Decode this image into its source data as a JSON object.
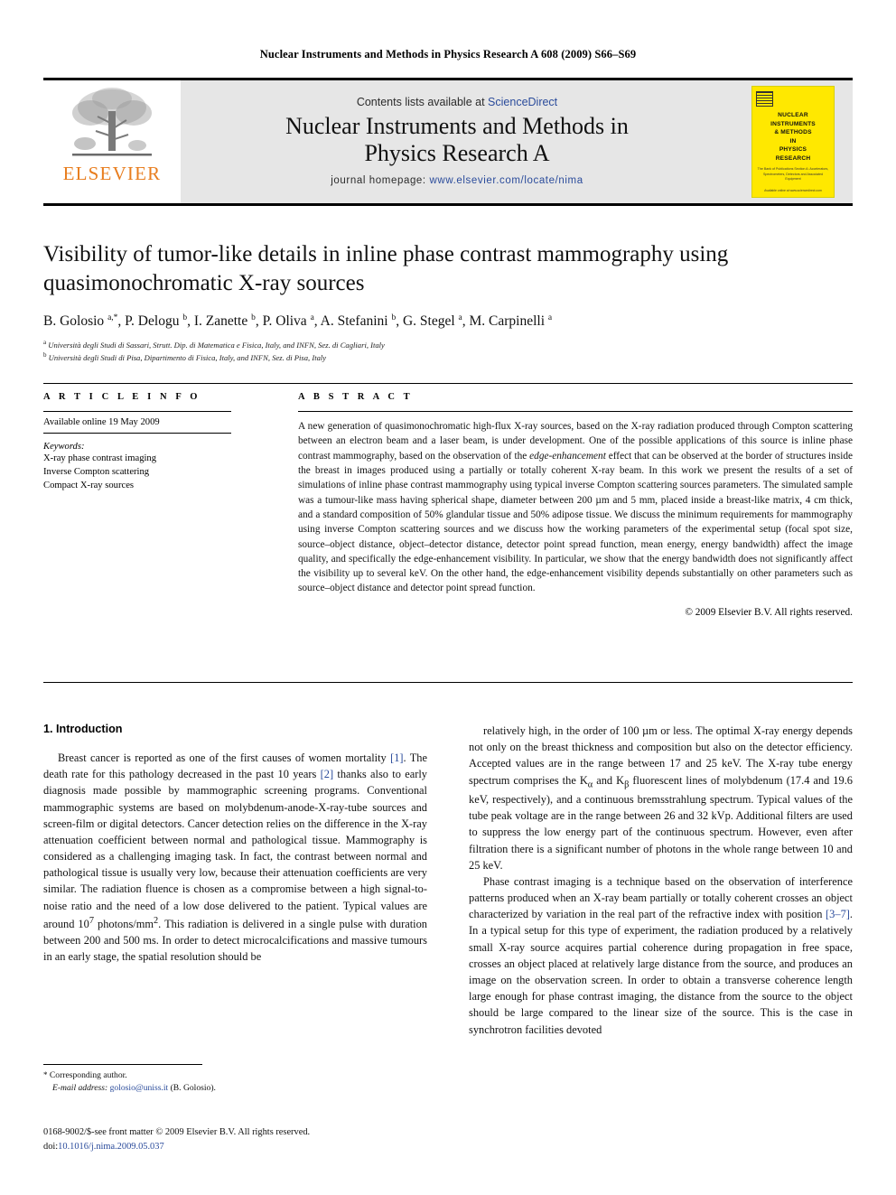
{
  "running_head": "Nuclear Instruments and Methods in Physics Research A 608 (2009) S66–S69",
  "masthead": {
    "publisher_logo_text": "ELSEVIER",
    "contents_prefix": "Contents lists available at",
    "contents_link": "ScienceDirect",
    "journal_title_line1": "Nuclear Instruments and Methods in",
    "journal_title_line2": "Physics Research A",
    "homepage_label": "journal homepage:",
    "homepage_url": "www.elsevier.com/locate/nima",
    "cover": {
      "title_line1": "NUCLEAR",
      "title_line2": "INSTRUMENTS",
      "title_line3": "& METHODS",
      "title_line4": "IN",
      "title_line5": "PHYSICS",
      "title_line6": "RESEARCH",
      "subtitle": "The Bank of Publications Section A: Accelerators, Spectrometers, Detectors and Associated Equipment",
      "footer": "Available online at www.sciencedirect.com"
    }
  },
  "article": {
    "title": "Visibility of tumor-like details in inline phase contrast mammography using quasimonochromatic X-ray sources",
    "authors_html": "B. Golosio <sup>a,</sup><sup>*</sup>, P. Delogu <sup>b</sup>, I. Zanette <sup>b</sup>, P. Oliva <sup>a</sup>, A. Stefanini <sup>b</sup>, G. Stegel <sup>a</sup>, M. Carpinelli <sup>a</sup>",
    "affiliation_a": "Università degli Studi di Sassari, Strutt. Dip. di Matematica e Fisica, Italy, and INFN, Sez. di Cagliari, Italy",
    "affiliation_b": "Università degli Studi di Pisa, Dipartimento di Fisica, Italy, and INFN, Sez. di Pisa, Italy"
  },
  "info": {
    "heading": "A R T I C L E   I N F O",
    "history": "Available online 19 May 2009",
    "keywords_label": "Keywords:",
    "keywords": [
      "X-ray phase contrast imaging",
      "Inverse Compton scattering",
      "Compact X-ray sources"
    ]
  },
  "abstract": {
    "heading": "A B S T R A C T",
    "paragraph_html": "A new generation of quasimonochromatic high-flux X-ray sources, based on the X-ray radiation produced through Compton scattering between an electron beam and a laser beam, is under development. One of the possible applications of this source is inline phase contrast mammography, based on the observation of the <i>edge-enhancement</i> effect that can be observed at the border of structures inside the breast in images produced using a partially or totally coherent X-ray beam. In this work we present the results of a set of simulations of inline phase contrast mammography using typical inverse Compton scattering sources parameters. The simulated sample was a tumour-like mass having spherical shape, diameter between 200 µm and 5 mm, placed inside a breast-like matrix, 4 cm thick, and a standard composition of 50% glandular tissue and 50% adipose tissue. We discuss the minimum requirements for mammography using inverse Compton scattering sources and we discuss how the working parameters of the experimental setup (focal spot size, source–object distance, object–detector distance, detector point spread function, mean energy, energy bandwidth) affect the image quality, and specifically the edge-enhancement visibility. In particular, we show that the energy bandwidth does not significantly affect the visibility up to several keV. On the other hand, the edge-enhancement visibility depends substantially on other parameters such as source–object distance and detector point spread function.",
    "copyright": "© 2009 Elsevier B.V. All rights reserved."
  },
  "body": {
    "section_title": "1.  Introduction",
    "left_paragraph_html": "Breast cancer is reported as one of the first causes of women mortality <span class=\"ref\">[1]</span>. The death rate for this pathology decreased in the past 10 years <span class=\"ref\">[2]</span> thanks also to early diagnosis made possible by mammographic screening programs. Conventional mammographic systems are based on molybdenum-anode-X-ray-tube sources and screen-film or digital detectors. Cancer detection relies on the difference in the X-ray attenuation coefficient between normal and pathological tissue. Mammography is considered as a challenging imaging task. In fact, the contrast between normal and pathological tissue is usually very low, because their attenuation coefficients are very similar. The radiation fluence is chosen as a compromise between a high signal-to-noise ratio and the need of a low dose delivered to the patient. Typical values are around 10<sup>7</sup> photons/mm<sup>2</sup>. This radiation is delivered in a single pulse with duration between 200 and 500 ms. In order to detect microcalcifications and massive tumours in an early stage, the spatial resolution should be",
    "right_paragraph1_html": "relatively high, in the order of 100 µm or less. The optimal X-ray energy depends not only on the breast thickness and composition but also on the detector efficiency. Accepted values are in the range between 17 and 25 keV. The X-ray tube energy spectrum comprises the K<sub>α</sub> and K<sub>β</sub> fluorescent lines of molybdenum (17.4 and 19.6 keV, respectively), and a continuous bremsstrahlung spectrum. Typical values of the tube peak voltage are in the range between 26 and 32 kVp. Additional filters are used to suppress the low energy part of the continuous spectrum. However, even after filtration there is a significant number of photons in the whole range between 10 and 25 keV.",
    "right_paragraph2_html": "Phase contrast imaging is a technique based on the observation of interference patterns produced when an X-ray beam partially or totally coherent crosses an object characterized by variation in the real part of the refractive index with position <span class=\"ref\">[3–7]</span>. In a typical setup for this type of experiment, the radiation produced by a relatively small X-ray source acquires partial coherence during propagation in free space, crosses an object placed at relatively large distance from the source, and produces an image on the observation screen. In order to obtain a transverse coherence length large enough for phase contrast imaging, the distance from the source to the object should be large compared to the linear size of the source. This is the case in synchrotron facilities devoted"
  },
  "footnotes": {
    "corresponding_author": "Corresponding author.",
    "email_label": "E-mail address:",
    "email": "golosio@uniss.it",
    "email_owner": "(B. Golosio)."
  },
  "imprint": {
    "front_matter": "0168-9002/$-see front matter © 2009 Elsevier B.V. All rights reserved.",
    "doi_label": "doi:",
    "doi_value": "10.1016/j.nima.2009.05.037"
  },
  "colors": {
    "link": "#2a4b9b",
    "elsevier_orange": "#E87D1E",
    "masthead_gray": "#E6E6E6",
    "cover_yellow": "#FFE800"
  }
}
